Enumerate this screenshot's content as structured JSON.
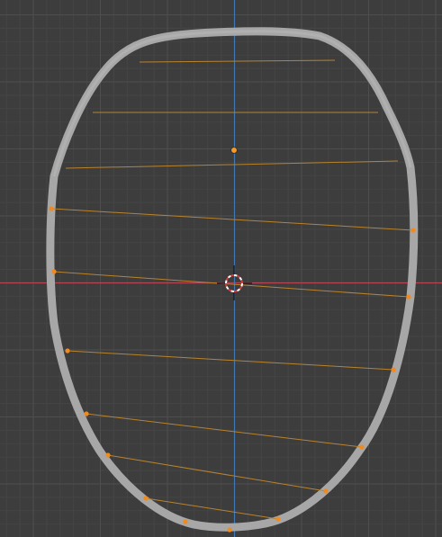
{
  "viewport": {
    "background": "#3d3d3d",
    "grid_minor_color": "#454545",
    "grid_major_color": "#4e4e4e",
    "x_axis_color": "#b54554",
    "y_axis_color": "#3f78b5",
    "curve_fill_color": "#a7a7a7",
    "curve_edge_color": "#8c8c8c",
    "handle_line_color": "#b8832e",
    "vertex_color": "#f08a1e",
    "origin_color": "#f39a2a",
    "cursor_red": "#d83b3b",
    "cursor_white": "#ffffff"
  },
  "object": {
    "kind": "curve",
    "shading": "solid gray",
    "control_points_visible": true
  },
  "tools": {
    "cursor_icon": "3d-cursor-icon",
    "origin_icon": "object-origin-icon"
  }
}
